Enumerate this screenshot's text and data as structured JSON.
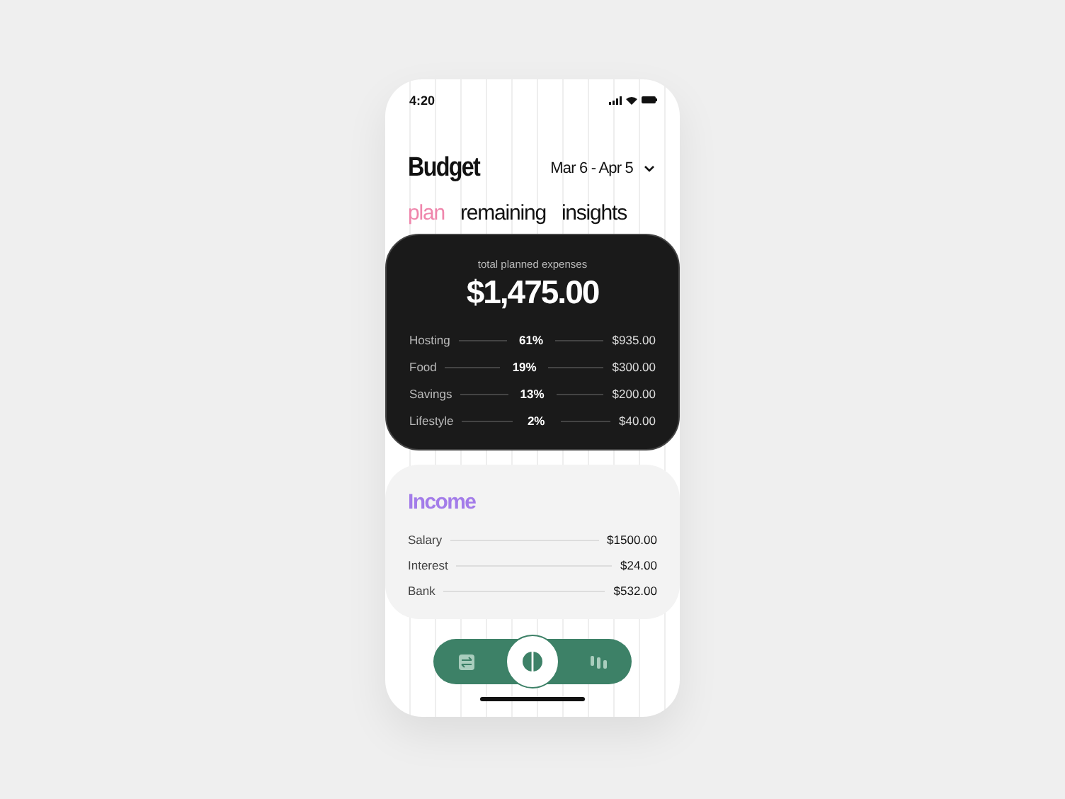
{
  "status_bar": {
    "time": "4:20"
  },
  "header": {
    "title": "Budget",
    "date_range": "Mar 6 - Apr 5"
  },
  "tabs": [
    {
      "label": "plan",
      "selected": true
    },
    {
      "label": "remaining",
      "selected": false
    },
    {
      "label": "insights",
      "selected": false
    }
  ],
  "expenses": {
    "caption": "total planned expenses",
    "total": "$1,475.00",
    "rows": [
      {
        "name": "Hosting",
        "percent": "61%",
        "amount": "$935.00"
      },
      {
        "name": "Food",
        "percent": "19%",
        "amount": "$300.00"
      },
      {
        "name": "Savings",
        "percent": "13%",
        "amount": "$200.00"
      },
      {
        "name": "Lifestyle",
        "percent": "2%",
        "amount": "$40.00"
      }
    ]
  },
  "income": {
    "title": "Income",
    "rows": [
      {
        "name": "Salary",
        "amount": "$1500.00"
      },
      {
        "name": "Interest",
        "amount": "$24.00"
      },
      {
        "name": "Bank",
        "amount": "$532.00"
      }
    ]
  },
  "nav": [
    {
      "kind": "transfer",
      "selected": false
    },
    {
      "kind": "pie",
      "selected": true
    },
    {
      "kind": "candles",
      "selected": false
    }
  ]
}
